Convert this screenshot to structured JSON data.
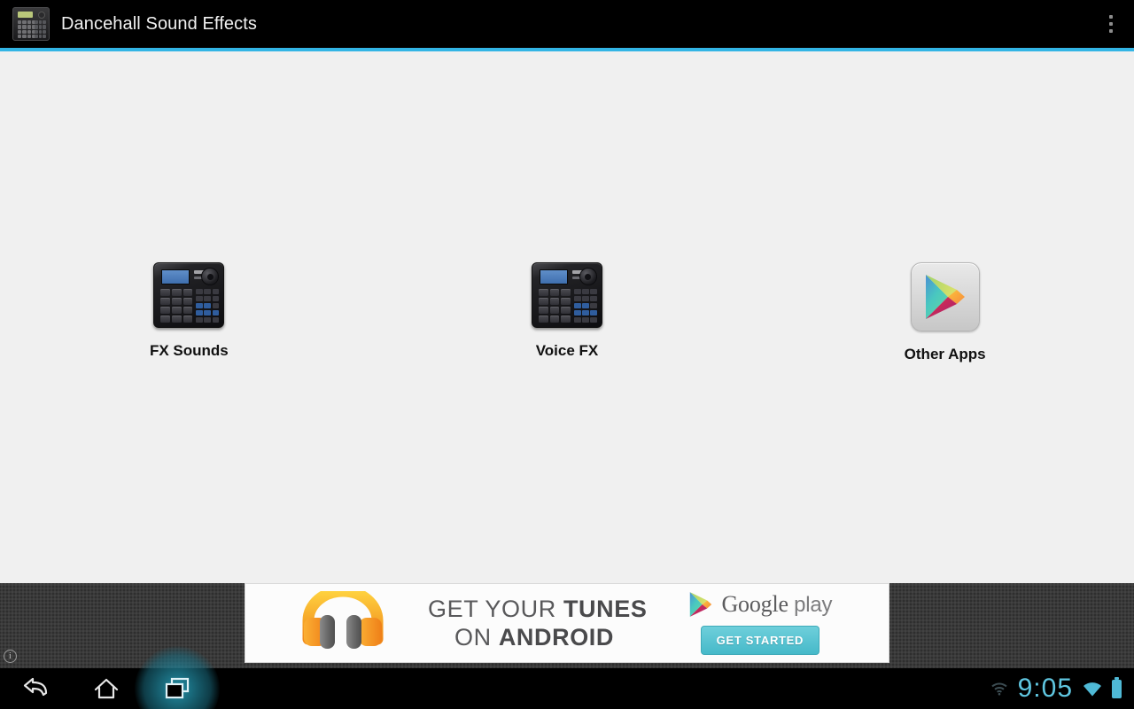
{
  "titlebar": {
    "app_icon_name": "drum-machine-app-icon",
    "title": "Dancehall Sound Effects",
    "overflow_label": "More options"
  },
  "main": {
    "items": [
      {
        "label": "FX Sounds",
        "icon": "drum-machine-icon"
      },
      {
        "label": "Voice FX",
        "icon": "drum-machine-icon"
      },
      {
        "label": "Other Apps",
        "icon": "google-play-store-icon"
      }
    ]
  },
  "ad": {
    "info_badge": "i",
    "headphones_icon": "headphones-icon",
    "line1_plain": "GET YOUR ",
    "line1_bold": "TUNES",
    "line2_plain": "ON ",
    "line2_bold": "ANDROID",
    "brand_google": "Google",
    "brand_play": "play",
    "cta_label": "GET STARTED"
  },
  "navbar": {
    "back_label": "Back",
    "home_label": "Home",
    "recents_label": "Recent apps",
    "clock": "9:05",
    "wifi_dim": "wifi-icon-dim",
    "wifi": "wifi-icon",
    "battery": "battery-icon"
  },
  "colors": {
    "accent": "#33b5e5",
    "system_teal": "#5fc6e0",
    "content_bg": "#f0f0f0",
    "titlebar_bg": "#000000",
    "cta_teal": "#46b9c9"
  }
}
